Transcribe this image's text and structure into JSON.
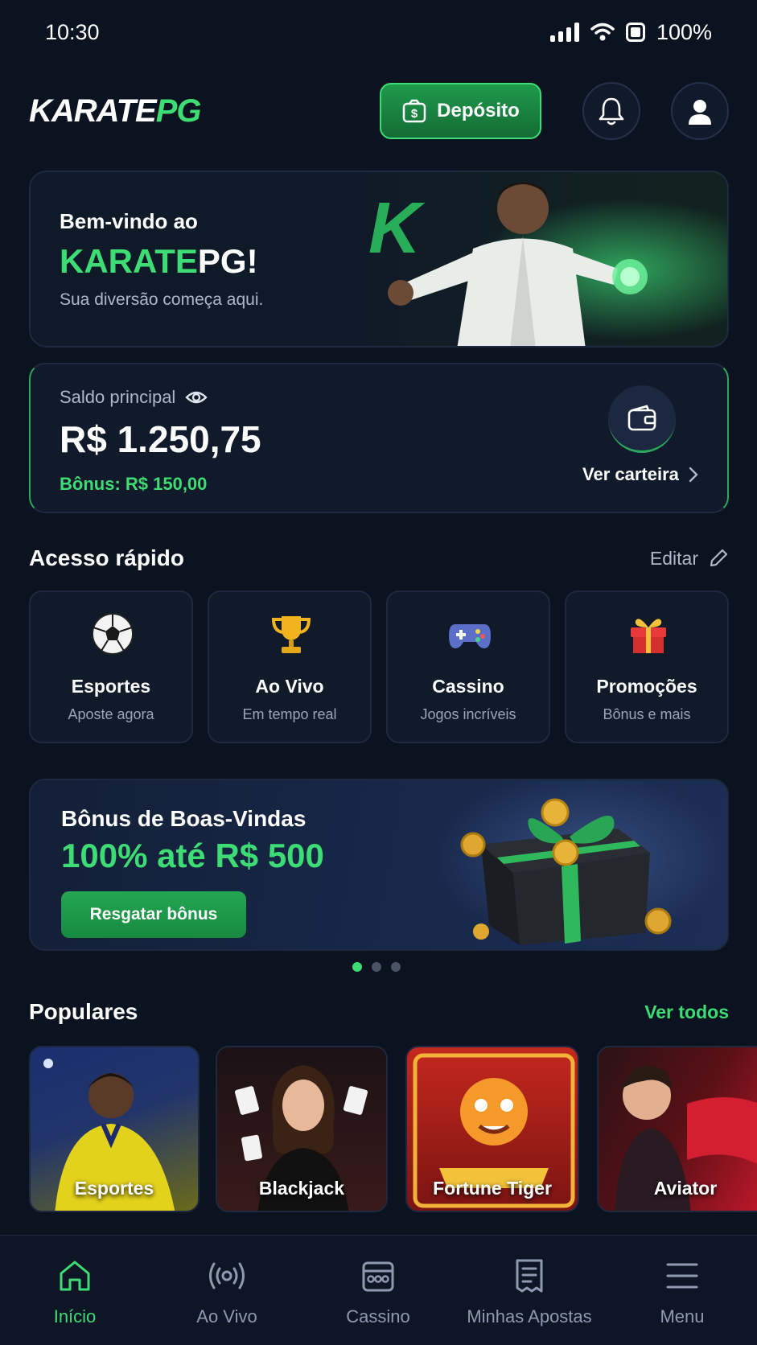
{
  "status": {
    "time": "10:30",
    "battery": "100%"
  },
  "header": {
    "logo_main": "KARATE",
    "logo_accent": "PG",
    "deposit_label": "Depósito"
  },
  "hero": {
    "welcome": "Bem-vindo ao",
    "brand_green": "KARATE",
    "brand_white": "PG!",
    "subtitle": "Sua diversão começa aqui."
  },
  "balance": {
    "label": "Saldo principal",
    "value": "R$ 1.250,75",
    "bonus": "Bônus: R$ 150,00",
    "wallet_link": "Ver carteira"
  },
  "quick_access": {
    "title": "Acesso rápido",
    "edit_label": "Editar",
    "items": [
      {
        "title": "Esportes",
        "subtitle": "Aposte agora",
        "icon": "soccer-ball-icon"
      },
      {
        "title": "Ao Vivo",
        "subtitle": "Em tempo real",
        "icon": "trophy-icon"
      },
      {
        "title": "Cassino",
        "subtitle": "Jogos incríveis",
        "icon": "gamepad-icon"
      },
      {
        "title": "Promoções",
        "subtitle": "Bônus e mais",
        "icon": "gift-icon"
      }
    ]
  },
  "promo": {
    "title": "Bônus de Boas-Vindas",
    "amount": "100% até R$ 500",
    "button": "Resgatar bônus",
    "active_slide": 1,
    "slides": 3
  },
  "popular": {
    "title": "Populares",
    "see_all": "Ver todos",
    "games": [
      {
        "label": "Esportes"
      },
      {
        "label": "Blackjack"
      },
      {
        "label": "Fortune Tiger"
      },
      {
        "label": "Aviator"
      }
    ]
  },
  "nav": {
    "items": [
      {
        "label": "Início",
        "icon": "home-icon",
        "active": true
      },
      {
        "label": "Ao Vivo",
        "icon": "live-broadcast-icon"
      },
      {
        "label": "Cassino",
        "icon": "slot-machine-icon"
      },
      {
        "label": "Minhas Apostas",
        "icon": "bet-slip-icon"
      },
      {
        "label": "Menu",
        "icon": "hamburger-menu-icon"
      }
    ]
  },
  "colors": {
    "accent": "#3ddc74",
    "background": "#0b1220",
    "card": "#101a2a"
  }
}
